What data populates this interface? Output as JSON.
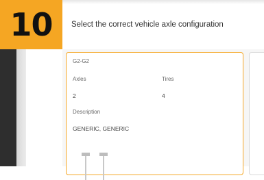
{
  "step": {
    "number": "10",
    "color": "#f5a623"
  },
  "dialog": {
    "title": "Select the correct vehicle axle configuration"
  },
  "card": {
    "code": "G2-G2",
    "axles_label": "Axles",
    "axles_value": "2",
    "tires_label": "Tires",
    "tires_value": "4",
    "description_label": "Description",
    "description_value": "GENERIC, GENERIC",
    "selected": true,
    "border_color": "#f5a623"
  },
  "icons": {
    "axle_diagram": "axle-diagram-icon"
  }
}
